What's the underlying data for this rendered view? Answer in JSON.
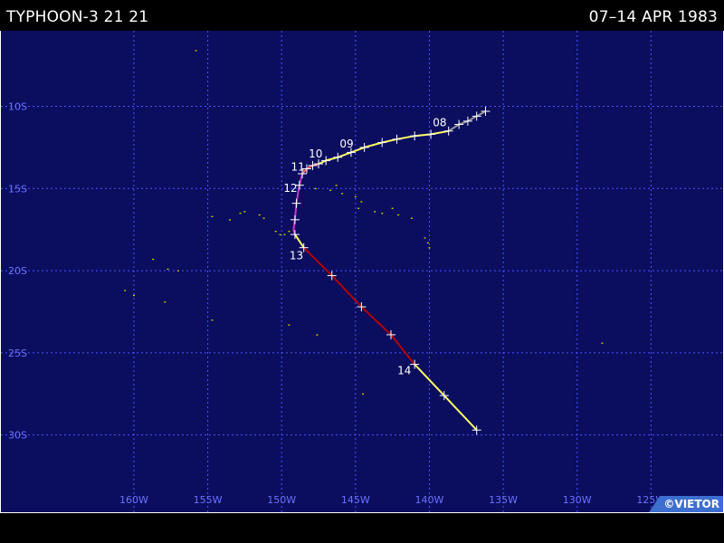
{
  "header": {
    "title_left": "TYPHOON-3 21 21",
    "title_right": "07–14 APR 1983"
  },
  "map": {
    "bounds": {
      "lon_min": -169.0,
      "lon_max": -120.0,
      "lat_min": -34.7,
      "lat_max": -5.4
    },
    "grid_lons": [
      -160,
      -155,
      -150,
      -145,
      -140,
      -135,
      -130,
      -125
    ],
    "grid_lats": [
      -10,
      -15,
      -20,
      -25,
      -30
    ],
    "lon_labels": [
      "160W",
      "155W",
      "150W",
      "145W",
      "140W",
      "135W",
      "130W",
      "125W"
    ],
    "lat_labels": [
      "10S",
      "15S",
      "20S",
      "25S",
      "30S"
    ],
    "colors": {
      "ocean": "#0b0d5e",
      "grid": "#4a55ff",
      "depression": "#999999",
      "storm": "#ffff66",
      "cat1": "#ff6a6a",
      "cat2": "#cc33cc",
      "weakening": "#b30000",
      "islands": "#d4d400"
    },
    "track_segments": [
      {
        "intensity": "depression",
        "points": [
          [
            -136.2,
            -10.3
          ],
          [
            -136.8,
            -10.6
          ],
          [
            -137.4,
            -10.9
          ],
          [
            -138.0,
            -11.1
          ],
          [
            -138.7,
            -11.5
          ]
        ]
      },
      {
        "intensity": "storm",
        "points": [
          [
            -138.7,
            -11.5
          ],
          [
            -139.9,
            -11.7
          ],
          [
            -141.0,
            -11.8
          ],
          [
            -142.2,
            -12.0
          ],
          [
            -143.2,
            -12.2
          ],
          [
            -144.4,
            -12.5
          ],
          [
            -145.3,
            -12.8
          ],
          [
            -146.2,
            -13.1
          ],
          [
            -147.0,
            -13.3
          ],
          [
            -147.5,
            -13.5
          ]
        ]
      },
      {
        "intensity": "cat1",
        "points": [
          [
            -147.5,
            -13.5
          ],
          [
            -147.9,
            -13.6
          ],
          [
            -148.3,
            -13.8
          ],
          [
            -148.6,
            -14.1
          ]
        ]
      },
      {
        "intensity": "cat2",
        "points": [
          [
            -148.6,
            -14.1
          ],
          [
            -148.8,
            -14.8
          ],
          [
            -149.0,
            -15.9
          ],
          [
            -149.1,
            -16.9
          ],
          [
            -149.2,
            -17.5
          ],
          [
            -149.1,
            -17.8
          ]
        ]
      },
      {
        "intensity": "storm",
        "points": [
          [
            -149.1,
            -17.8
          ],
          [
            -148.5,
            -18.6
          ]
        ]
      },
      {
        "intensity": "weakening",
        "points": [
          [
            -148.5,
            -18.6
          ],
          [
            -146.6,
            -20.3
          ],
          [
            -144.6,
            -22.2
          ],
          [
            -142.6,
            -23.9
          ],
          [
            -141.0,
            -25.7
          ]
        ]
      },
      {
        "intensity": "storm",
        "points": [
          [
            -141.0,
            -25.7
          ],
          [
            -139.0,
            -27.6
          ],
          [
            -136.8,
            -29.7
          ]
        ]
      }
    ],
    "track_markers": [
      [
        -136.2,
        -10.3
      ],
      [
        -136.8,
        -10.6
      ],
      [
        -137.4,
        -10.9
      ],
      [
        -138.0,
        -11.1
      ],
      [
        -138.7,
        -11.5
      ],
      [
        -139.9,
        -11.7
      ],
      [
        -141.0,
        -11.8
      ],
      [
        -142.2,
        -12.0
      ],
      [
        -143.2,
        -12.2
      ],
      [
        -144.4,
        -12.5
      ],
      [
        -145.3,
        -12.8
      ],
      [
        -146.2,
        -13.1
      ],
      [
        -147.0,
        -13.3
      ],
      [
        -147.5,
        -13.5
      ],
      [
        -147.9,
        -13.6
      ],
      [
        -148.3,
        -13.8
      ],
      [
        -148.6,
        -14.1
      ],
      [
        -148.8,
        -14.8
      ],
      [
        -149.0,
        -15.9
      ],
      [
        -149.1,
        -16.9
      ],
      [
        -149.1,
        -17.8
      ],
      [
        -148.5,
        -18.6
      ],
      [
        -146.6,
        -20.3
      ],
      [
        -144.6,
        -22.2
      ],
      [
        -142.6,
        -23.9
      ],
      [
        -141.0,
        -25.7
      ],
      [
        -139.0,
        -27.6
      ],
      [
        -136.8,
        -29.7
      ]
    ],
    "day_labels": [
      {
        "text": "08",
        "lon": -139.3,
        "lat": -11.2
      },
      {
        "text": "09",
        "lon": -145.6,
        "lat": -12.5
      },
      {
        "text": "10",
        "lon": -147.7,
        "lat": -13.1
      },
      {
        "text": "11",
        "lon": -148.9,
        "lat": -13.9
      },
      {
        "text": "12",
        "lon": -149.4,
        "lat": -15.2
      },
      {
        "text": "13",
        "lon": -149.0,
        "lat": -19.3
      },
      {
        "text": "14",
        "lon": -141.7,
        "lat": -26.3
      }
    ],
    "islands": [
      [
        -150.4,
        -17.6
      ],
      [
        -150.1,
        -17.8
      ],
      [
        -149.8,
        -17.8
      ],
      [
        -149.5,
        -17.6
      ],
      [
        -151.5,
        -16.6
      ],
      [
        -151.2,
        -16.8
      ],
      [
        -152.5,
        -16.4
      ],
      [
        -152.8,
        -16.5
      ],
      [
        -154.7,
        -16.7
      ],
      [
        -153.5,
        -16.9
      ],
      [
        -145.0,
        -15.5
      ],
      [
        -145.9,
        -15.3
      ],
      [
        -144.6,
        -15.8
      ],
      [
        -143.7,
        -16.4
      ],
      [
        -143.2,
        -16.5
      ],
      [
        -142.5,
        -16.2
      ],
      [
        -142.1,
        -16.6
      ],
      [
        -141.2,
        -16.8
      ],
      [
        -140.3,
        -18.0
      ],
      [
        -140.1,
        -18.3
      ],
      [
        -140.0,
        -18.6
      ],
      [
        -144.8,
        -16.2
      ],
      [
        -146.3,
        -14.8
      ],
      [
        -146.7,
        -15.1
      ],
      [
        -147.7,
        -15.0
      ],
      [
        -157.7,
        -19.9
      ],
      [
        -157.0,
        -20.0
      ],
      [
        -158.7,
        -19.3
      ],
      [
        -160.6,
        -21.2
      ],
      [
        -160.0,
        -21.5
      ],
      [
        -157.9,
        -21.9
      ],
      [
        -154.7,
        -23.0
      ],
      [
        -149.5,
        -23.3
      ],
      [
        -147.6,
        -23.9
      ],
      [
        -144.5,
        -27.5
      ],
      [
        -128.3,
        -24.4
      ],
      [
        -155.8,
        -6.6
      ]
    ]
  },
  "credit": "©VIETOR"
}
